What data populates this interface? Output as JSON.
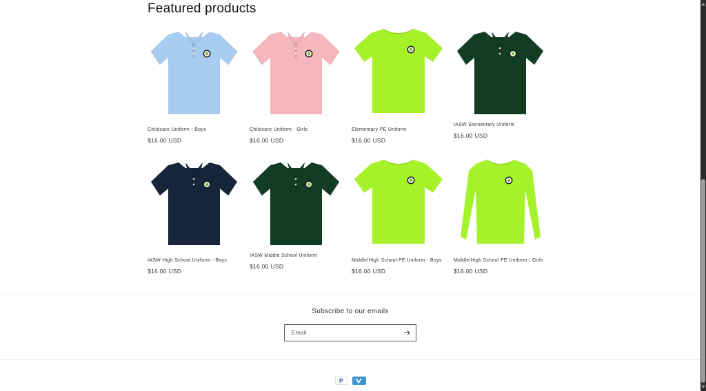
{
  "section": {
    "heading": "Featured products"
  },
  "products": [
    {
      "title": "Childcare Uniform - Boys",
      "price": "$16.00 USD",
      "style": "polo",
      "color": "#a9cdf0"
    },
    {
      "title": "Childcare Uniform - Girls",
      "price": "$16.00 USD",
      "style": "polo",
      "color": "#f5b6bd"
    },
    {
      "title": "Elementary PE Uniform",
      "price": "$16.00 USD",
      "style": "tee",
      "color": "#a6f22a"
    },
    {
      "title": "IASW Elementary Uniform",
      "price": "$16.00 USD",
      "style": "polo",
      "color": "#133d22"
    },
    {
      "title": "IASW High School Uniform - Boys",
      "price": "$16.00 USD",
      "style": "polo",
      "color": "#15263b"
    },
    {
      "title": "IASW Middle School Uniform",
      "price": "$16.00 USD",
      "style": "polo",
      "color": "#133d22"
    },
    {
      "title": "Middle/High School PE Uniform - Boys",
      "price": "$16.00 USD",
      "style": "tee",
      "color": "#a6f22a"
    },
    {
      "title": "Middle/High School PE Uniform - Girls",
      "price": "$16.00 USD",
      "style": "longsleeve",
      "color": "#a6f22a"
    }
  ],
  "newsletter": {
    "title": "Subscribe to our emails",
    "email_placeholder": "Email",
    "submit_icon": "arrow-right-icon"
  },
  "payment_icons": [
    "paypal-icon",
    "venmo-icon"
  ]
}
